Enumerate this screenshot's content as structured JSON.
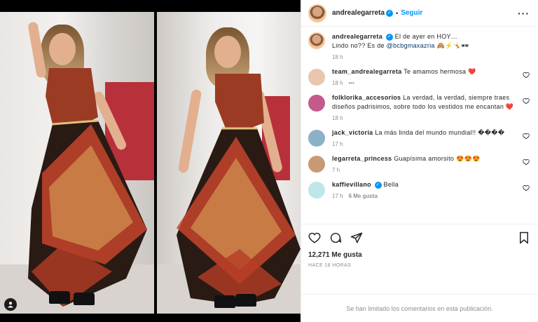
{
  "post": {
    "username": "andrealegarreta",
    "follow_label": "Seguir",
    "caption_line1": "El de ayer en HOY…",
    "caption_line2_prefix": "Lindo no?? Es de ",
    "caption_mention": "@bcbgmaxazria",
    "caption_emojis": "🙈⚡🤸🕶",
    "caption_time": "18 h",
    "likes": "12,271 Me gusta",
    "time_ago": "HACE 18 HORAS",
    "comments_limited": "Se han limitado los comentarios en esta publicación."
  },
  "comments": [
    {
      "user": "team_andrealegarreta",
      "text": "Te amamos hermosa ❤️",
      "time": "18 h",
      "extra": "•••",
      "avatar_color": "#e9c6b0"
    },
    {
      "user": "folklorika_accesorios",
      "text": "La verdad, la verdad, siempre traes diseños padrisimos, sobre todo los vestidos me encantan ❤️",
      "time": "18 h",
      "extra": "",
      "avatar_color": "#c45a8c"
    },
    {
      "user": "jack_victoria",
      "text": "La más linda del mundo mundial!! ����",
      "time": "17 h",
      "extra": "",
      "avatar_color": "#8db0c9"
    },
    {
      "user": "legarreta_princess",
      "text": "Guapísima amorsito 😍😍😍",
      "time": "7 h",
      "extra": "",
      "avatar_color": "#c99a72"
    },
    {
      "user": "kaffievillano",
      "text": "Bella",
      "time": "17 h",
      "extra": "6 Me gusta",
      "avatar_color": "#bfe6e8",
      "verified": true
    }
  ],
  "icons": {
    "like": "heart-icon",
    "comment": "comment-icon",
    "share": "share-icon",
    "save": "bookmark-icon",
    "more": "more-options-icon",
    "user_badge": "user-tag-icon"
  },
  "colors": {
    "follow": "#0095f6",
    "verified": "#0095f6",
    "heart_red": "#ed4956"
  }
}
